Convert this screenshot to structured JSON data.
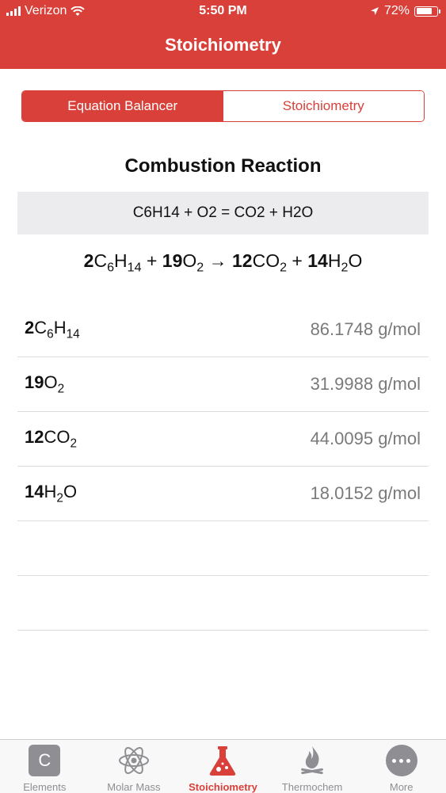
{
  "status_bar": {
    "carrier": "Verizon",
    "time": "5:50 PM",
    "battery": "72%",
    "battery_level": 0.72
  },
  "nav": {
    "title": "Stoichiometry"
  },
  "segmented": {
    "options": [
      "Equation Balancer",
      "Stoichiometry"
    ],
    "selected": "Equation Balancer"
  },
  "section_title": "Combustion Reaction",
  "equation_input": "C6H14 + O2 = CO2 + H2O",
  "balanced": {
    "terms": [
      {
        "coef": "2",
        "formula": "C6H14"
      },
      {
        "coef": "19",
        "formula": "O2"
      },
      {
        "coef": "12",
        "formula": "CO2"
      },
      {
        "coef": "14",
        "formula": "H2O"
      }
    ],
    "plus": "+",
    "arrow": "→"
  },
  "table": {
    "rows": [
      {
        "coef": "2",
        "formula": "C6H14",
        "molar_mass": "86.1748 g/mol"
      },
      {
        "coef": "19",
        "formula": "O2",
        "molar_mass": "31.9988 g/mol"
      },
      {
        "coef": "12",
        "formula": "CO2",
        "molar_mass": "44.0095 g/mol"
      },
      {
        "coef": "14",
        "formula": "H2O",
        "molar_mass": "18.0152 g/mol"
      },
      {
        "coef": "",
        "formula": "",
        "molar_mass": ""
      },
      {
        "coef": "",
        "formula": "",
        "molar_mass": ""
      }
    ]
  },
  "tabbar": {
    "items": [
      {
        "label": "Elements",
        "icon": "element-c-icon",
        "glyph": "C"
      },
      {
        "label": "Molar Mass",
        "icon": "atom-icon"
      },
      {
        "label": "Stoichiometry",
        "icon": "flask-icon",
        "active": true
      },
      {
        "label": "Thermochem",
        "icon": "fire-icon"
      },
      {
        "label": "More",
        "icon": "more-dots-icon"
      }
    ]
  },
  "colors": {
    "accent": "#d9403a",
    "inactive": "#8e8e93"
  }
}
